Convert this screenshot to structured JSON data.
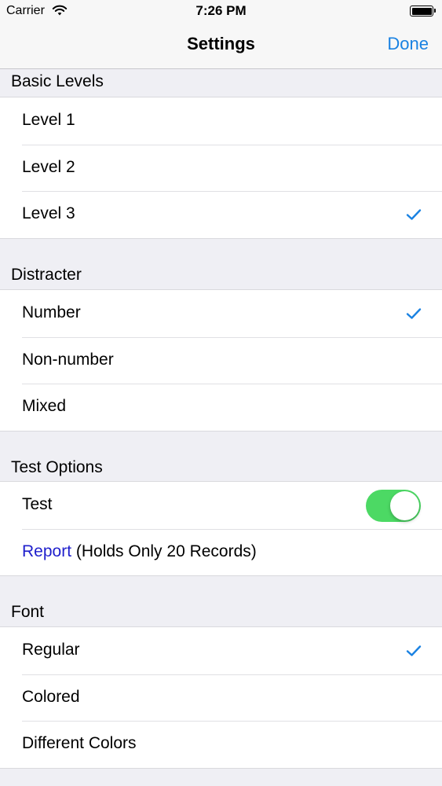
{
  "status_bar": {
    "carrier": "Carrier",
    "time": "7:26 PM"
  },
  "nav": {
    "title": "Settings",
    "done": "Done"
  },
  "sections": {
    "basic_levels": {
      "header": "Basic Levels",
      "items": [
        {
          "label": "Level 1",
          "checked": false
        },
        {
          "label": "Level 2",
          "checked": false
        },
        {
          "label": "Level 3",
          "checked": true
        }
      ]
    },
    "distracter": {
      "header": "Distracter",
      "items": [
        {
          "label": "Number",
          "checked": true
        },
        {
          "label": "Non-number",
          "checked": false
        },
        {
          "label": "Mixed",
          "checked": false
        }
      ]
    },
    "test_options": {
      "header": "Test Options",
      "test_label": "Test",
      "test_enabled": true,
      "report_link": "Report",
      "report_note": " (Holds Only 20 Records)"
    },
    "font": {
      "header": "Font",
      "items": [
        {
          "label": "Regular",
          "checked": true
        },
        {
          "label": "Colored",
          "checked": false
        },
        {
          "label": "Different Colors",
          "checked": false
        }
      ]
    }
  },
  "colors": {
    "accent": "#1a82e2",
    "toggle_on": "#4cd964",
    "report_link": "#1f1fcc",
    "background": "#efeff4"
  },
  "icons": {
    "wifi": "wifi-icon",
    "battery": "battery-icon",
    "check": "checkmark-icon"
  }
}
